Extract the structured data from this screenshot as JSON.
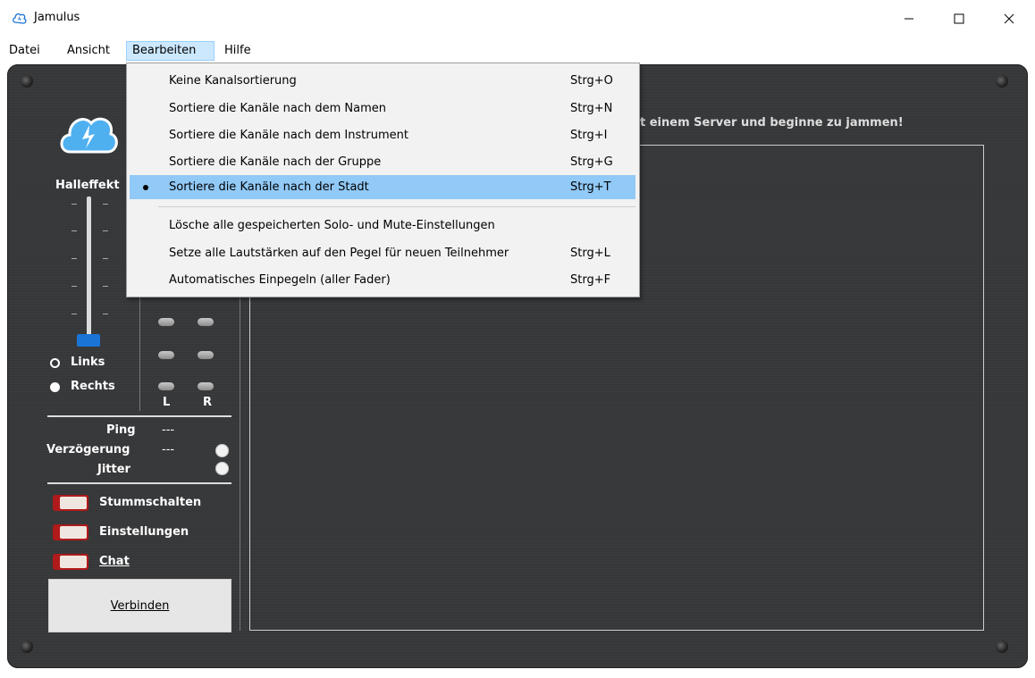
{
  "window": {
    "title": "Jamulus"
  },
  "menubar": {
    "items": [
      "Datei",
      "Ansicht",
      "Bearbeiten",
      "Hilfe"
    ],
    "active": "Bearbeiten"
  },
  "dropdown": {
    "items": [
      {
        "label": "Keine Kanalsortierung",
        "shortcut": "Strg+O"
      },
      {
        "label": "Sortiere die Kanäle nach dem Namen",
        "shortcut": "Strg+N"
      },
      {
        "label": "Sortiere die Kanäle nach dem Instrument",
        "shortcut": "Strg+I"
      },
      {
        "label": "Sortiere die Kanäle nach der Gruppe",
        "shortcut": "Strg+G"
      },
      {
        "label": "Sortiere die Kanäle nach der Stadt",
        "shortcut": "Strg+T",
        "checked": true
      },
      {
        "label": "Lösche alle gespeicherten Solo- und Mute-Einstellungen",
        "shortcut": ""
      },
      {
        "label": "Setze alle Lautstärken auf den Pegel für neuen Teilnehmer",
        "shortcut": "Strg+L"
      },
      {
        "label": "Automatisches Einpegeln (aller Fader)",
        "shortcut": "Strg+F"
      }
    ]
  },
  "main": {
    "hint": "t einem Server und beginne zu jammen!",
    "reverb_label": "Halleffekt",
    "radio": {
      "left": "Links",
      "right": "Rechts",
      "selected": "Rechts"
    },
    "meter": {
      "left": "L",
      "right": "R"
    },
    "stats": {
      "ping_label": "Ping",
      "ping_value": "---",
      "delay_label": "Verzögerung",
      "delay_value": "---",
      "jitter_label": "Jitter"
    },
    "switches": {
      "mute": "Stummschalten",
      "settings": "Einstellungen",
      "chat": "Chat"
    },
    "connect_button": "Verbinden",
    "accent": "#1a74d6"
  }
}
